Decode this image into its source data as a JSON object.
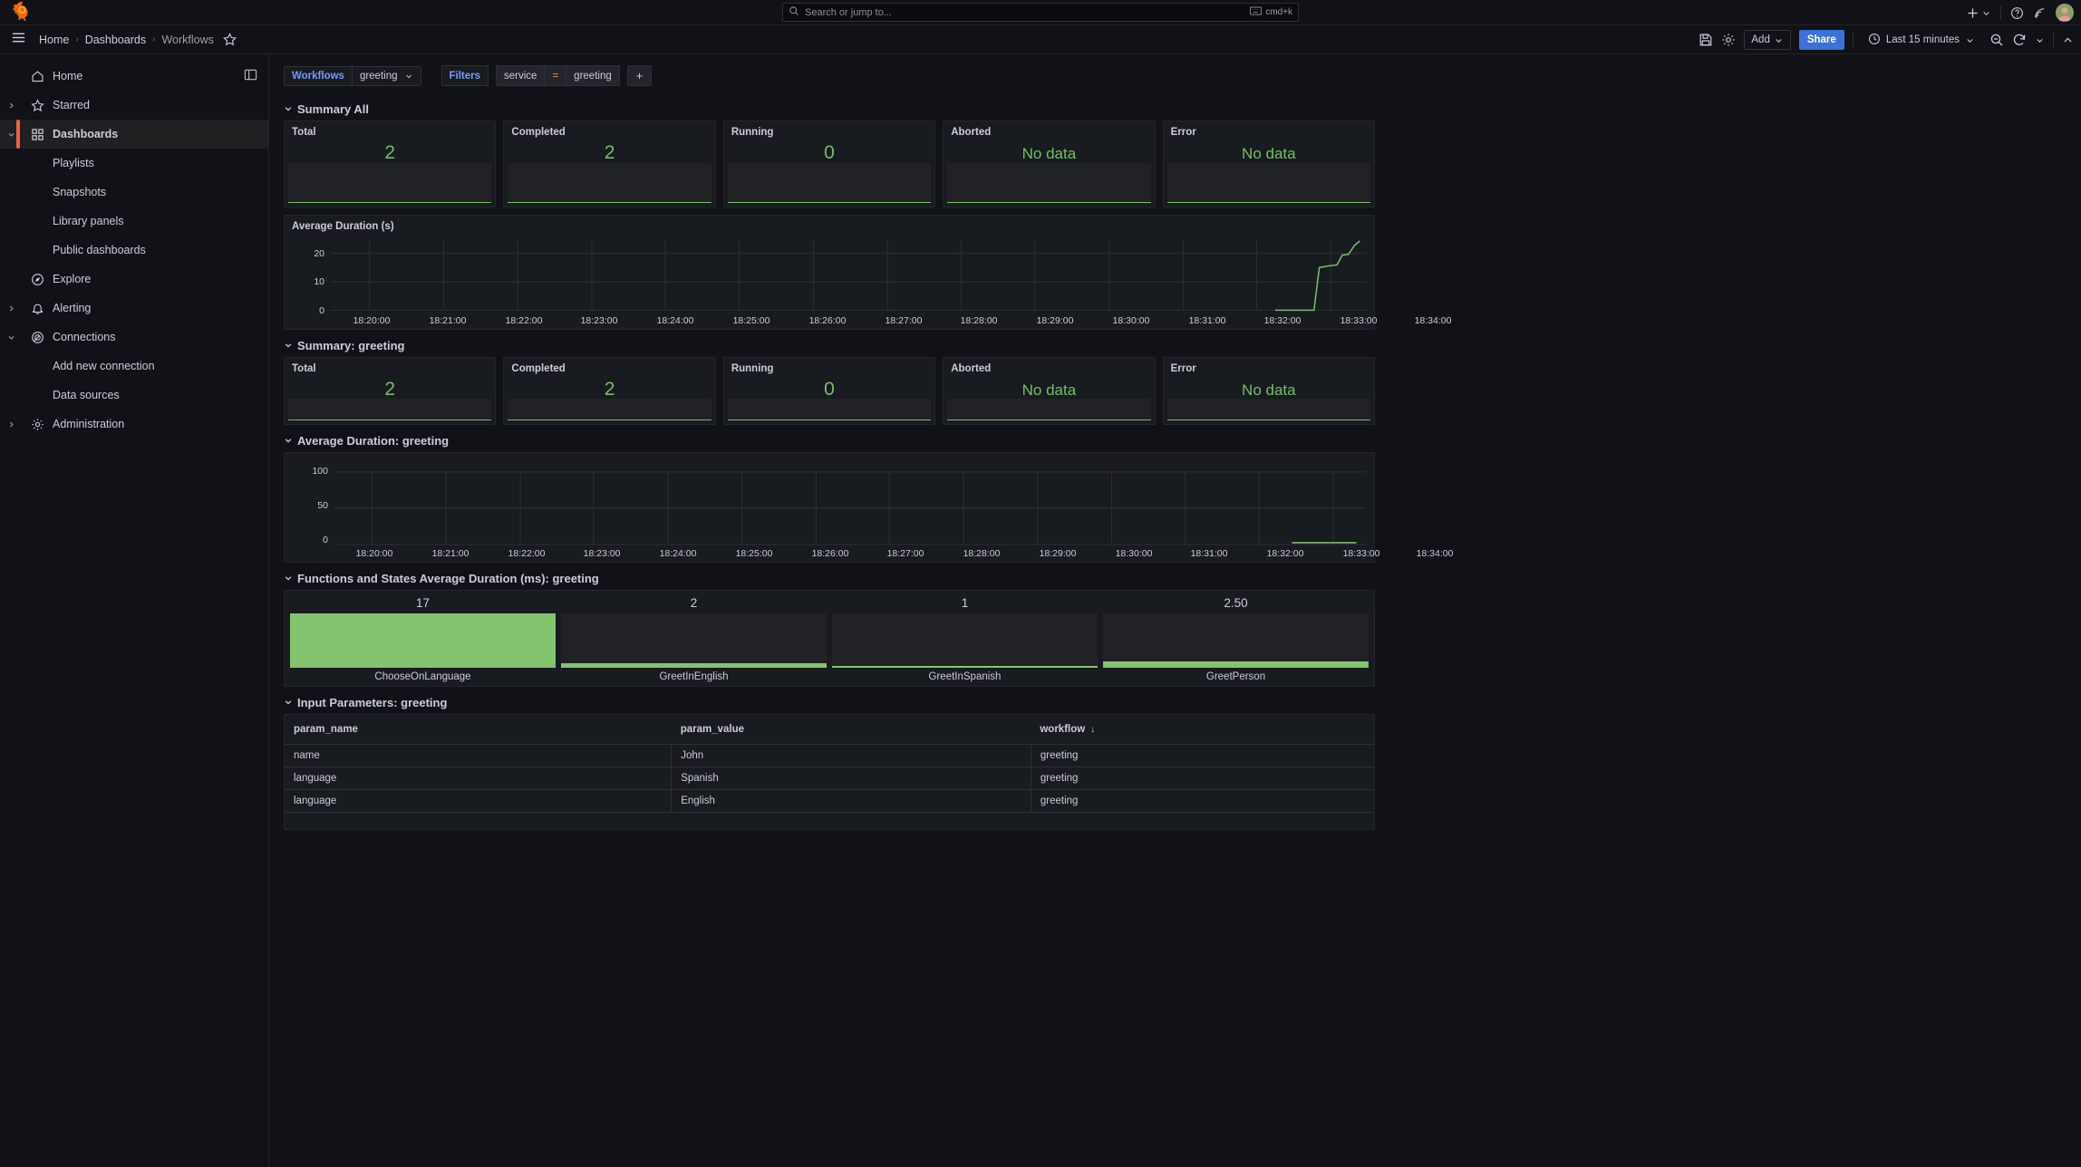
{
  "topbar": {
    "logo_icon": "grafana-logo-icon",
    "search_placeholder": "Search or jump to...",
    "search_icon": "search-icon",
    "kbd_icon": "keyboard-icon",
    "kbd_shortcut": "cmd+k",
    "plus_icon": "plus-icon",
    "chevron_icon": "chevron-down-icon",
    "help_icon": "help-circle-icon",
    "news_icon": "rss-icon",
    "avatar_icon": "user-avatar"
  },
  "breadcrumb": {
    "menu_icon": "hamburger-menu-icon",
    "items": [
      {
        "label": "Home"
      },
      {
        "label": "Dashboards"
      },
      {
        "label": "Workflows"
      }
    ],
    "separator": "›",
    "star_icon": "star-outline-icon"
  },
  "toolbar": {
    "save_icon": "save-disk-icon",
    "settings_icon": "gear-icon",
    "add_label": "Add",
    "add_chevron_icon": "chevron-down-icon",
    "share_label": "Share",
    "clock_icon": "clock-icon",
    "time_range": "Last 15 minutes",
    "time_chevron_icon": "chevron-down-icon",
    "zoom_out_icon": "zoom-out-icon",
    "refresh_icon": "refresh-icon",
    "refresh_chevron_icon": "chevron-down-icon",
    "collapse_icon": "chevron-up-icon"
  },
  "sidebar": {
    "dock_icon": "dock-menu-icon",
    "items": [
      {
        "label": "Home",
        "icon": "home-icon",
        "expandable": false,
        "child": false,
        "active": false
      },
      {
        "label": "Starred",
        "icon": "star-icon",
        "expandable": true,
        "expanded": false,
        "child": false,
        "active": false
      },
      {
        "label": "Dashboards",
        "icon": "dashboards-grid-icon",
        "expandable": true,
        "expanded": true,
        "child": false,
        "active": true
      },
      {
        "label": "Playlists",
        "icon": "",
        "expandable": false,
        "child": true,
        "active": false
      },
      {
        "label": "Snapshots",
        "icon": "",
        "expandable": false,
        "child": true,
        "active": false
      },
      {
        "label": "Library panels",
        "icon": "",
        "expandable": false,
        "child": true,
        "active": false
      },
      {
        "label": "Public dashboards",
        "icon": "",
        "expandable": false,
        "child": true,
        "active": false
      },
      {
        "label": "Explore",
        "icon": "compass-icon",
        "expandable": false,
        "child": false,
        "active": false
      },
      {
        "label": "Alerting",
        "icon": "bell-icon",
        "expandable": true,
        "expanded": false,
        "child": false,
        "active": false
      },
      {
        "label": "Connections",
        "icon": "connections-icon",
        "expandable": true,
        "expanded": true,
        "child": false,
        "active": false
      },
      {
        "label": "Add new connection",
        "icon": "",
        "expandable": false,
        "child": true,
        "active": false
      },
      {
        "label": "Data sources",
        "icon": "",
        "expandable": false,
        "child": true,
        "active": false
      },
      {
        "label": "Administration",
        "icon": "gear-icon",
        "expandable": true,
        "expanded": false,
        "child": false,
        "active": false
      }
    ]
  },
  "variables": {
    "workflow": {
      "label": "Workflows",
      "value": "greeting",
      "chevron_icon": "chevron-down-icon"
    },
    "filters": {
      "label": "Filters",
      "key": "service",
      "operator": "=",
      "value": "greeting",
      "add_label": "+"
    }
  },
  "rows": [
    {
      "title": "Summary All",
      "chevron_icon": "chevron-down-icon"
    },
    {
      "title": "Summary: greeting",
      "chevron_icon": "chevron-down-icon"
    },
    {
      "title": "Average Duration: greeting",
      "chevron_icon": "chevron-down-icon"
    },
    {
      "title": "Functions and States Average Duration (ms): greeting",
      "chevron_icon": "chevron-down-icon"
    },
    {
      "title": "Input Parameters: greeting",
      "chevron_icon": "chevron-down-icon"
    }
  ],
  "summary_all": [
    {
      "title": "Total",
      "value": "2"
    },
    {
      "title": "Completed",
      "value": "2"
    },
    {
      "title": "Running",
      "value": "0"
    },
    {
      "title": "Aborted",
      "value": "No data"
    },
    {
      "title": "Error",
      "value": "No data"
    }
  ],
  "summary_greeting": [
    {
      "title": "Total",
      "value": "2"
    },
    {
      "title": "Completed",
      "value": "2"
    },
    {
      "title": "Running",
      "value": "0"
    },
    {
      "title": "Aborted",
      "value": "No data"
    },
    {
      "title": "Error",
      "value": "No data"
    }
  ],
  "panels": {
    "avg_duration_all_title": "Average Duration (s)",
    "table_title": "Input Parameters: greeting"
  },
  "colors": {
    "accent_orange": "#f55f3e",
    "green": "#73bf69",
    "bar_green": "#85c46f",
    "blue_link": "#6e9fff",
    "share_blue": "#3d71d9",
    "panel_bg": "#181b1f",
    "page_bg": "#111217",
    "op_orange": "#ff9830"
  },
  "chart_data": [
    {
      "type": "line",
      "title": "Average Duration (s)",
      "xlabel": "",
      "ylabel": "",
      "ylim": [
        0,
        25
      ],
      "yticks": [
        0,
        10,
        20
      ],
      "ytick_labels": [
        "0",
        "10",
        "20"
      ],
      "xtick_labels": [
        "18:20:00",
        "18:21:00",
        "18:22:00",
        "18:23:00",
        "18:24:00",
        "18:25:00",
        "18:26:00",
        "18:27:00",
        "18:28:00",
        "18:29:00",
        "18:30:00",
        "18:31:00",
        "18:32:00",
        "18:33:00",
        "18:34:00"
      ],
      "grid": true,
      "legend": "none",
      "line_color": "#73bf69",
      "series": [
        {
          "name": "avg duration",
          "x": [
            "18:32:40",
            "18:33:15",
            "18:33:22",
            "18:33:30",
            "18:33:42",
            "18:33:48",
            "18:33:55",
            "18:34:02",
            "18:34:10"
          ],
          "values": [
            0,
            0,
            13.5,
            14.0,
            14.2,
            16.5,
            17.0,
            19.5,
            22.0
          ]
        }
      ]
    },
    {
      "type": "line",
      "title": "Average Duration: greeting",
      "xlabel": "",
      "ylabel": "",
      "ylim": [
        0,
        115
      ],
      "yticks": [
        0,
        50,
        100
      ],
      "ytick_labels": [
        "0",
        "50",
        "100"
      ],
      "xtick_labels": [
        "18:20:00",
        "18:21:00",
        "18:22:00",
        "18:23:00",
        "18:24:00",
        "18:25:00",
        "18:26:00",
        "18:27:00",
        "18:28:00",
        "18:29:00",
        "18:30:00",
        "18:31:00",
        "18:32:00",
        "18:33:00",
        "18:34:00"
      ],
      "grid": true,
      "legend": "none",
      "line_color": "#73bf69",
      "series": [
        {
          "name": "avg duration greeting",
          "x": [
            "18:33:10",
            "18:34:05"
          ],
          "values": [
            2,
            2
          ]
        }
      ]
    },
    {
      "type": "bar",
      "title": "Functions and States Average Duration (ms): greeting",
      "orientation": "vertical",
      "categories": [
        "ChooseOnLanguage",
        "GreetInEnglish",
        "GreetInSpanish",
        "GreetPerson"
      ],
      "values": [
        17,
        2,
        1,
        2.5
      ],
      "value_labels": [
        "17",
        "2",
        "1",
        "2.50"
      ],
      "max": 17,
      "bar_color": "#85c46f"
    }
  ],
  "table": {
    "columns": [
      {
        "label": "param_name",
        "sorted": false
      },
      {
        "label": "param_value",
        "sorted": false
      },
      {
        "label": "workflow",
        "sorted": true,
        "sort_icon": "arrow-down-icon"
      }
    ],
    "rows": [
      {
        "param_name": "name",
        "param_value": "John",
        "workflow": "greeting"
      },
      {
        "param_name": "language",
        "param_value": "Spanish",
        "workflow": "greeting"
      },
      {
        "param_name": "language",
        "param_value": "English",
        "workflow": "greeting"
      }
    ]
  }
}
